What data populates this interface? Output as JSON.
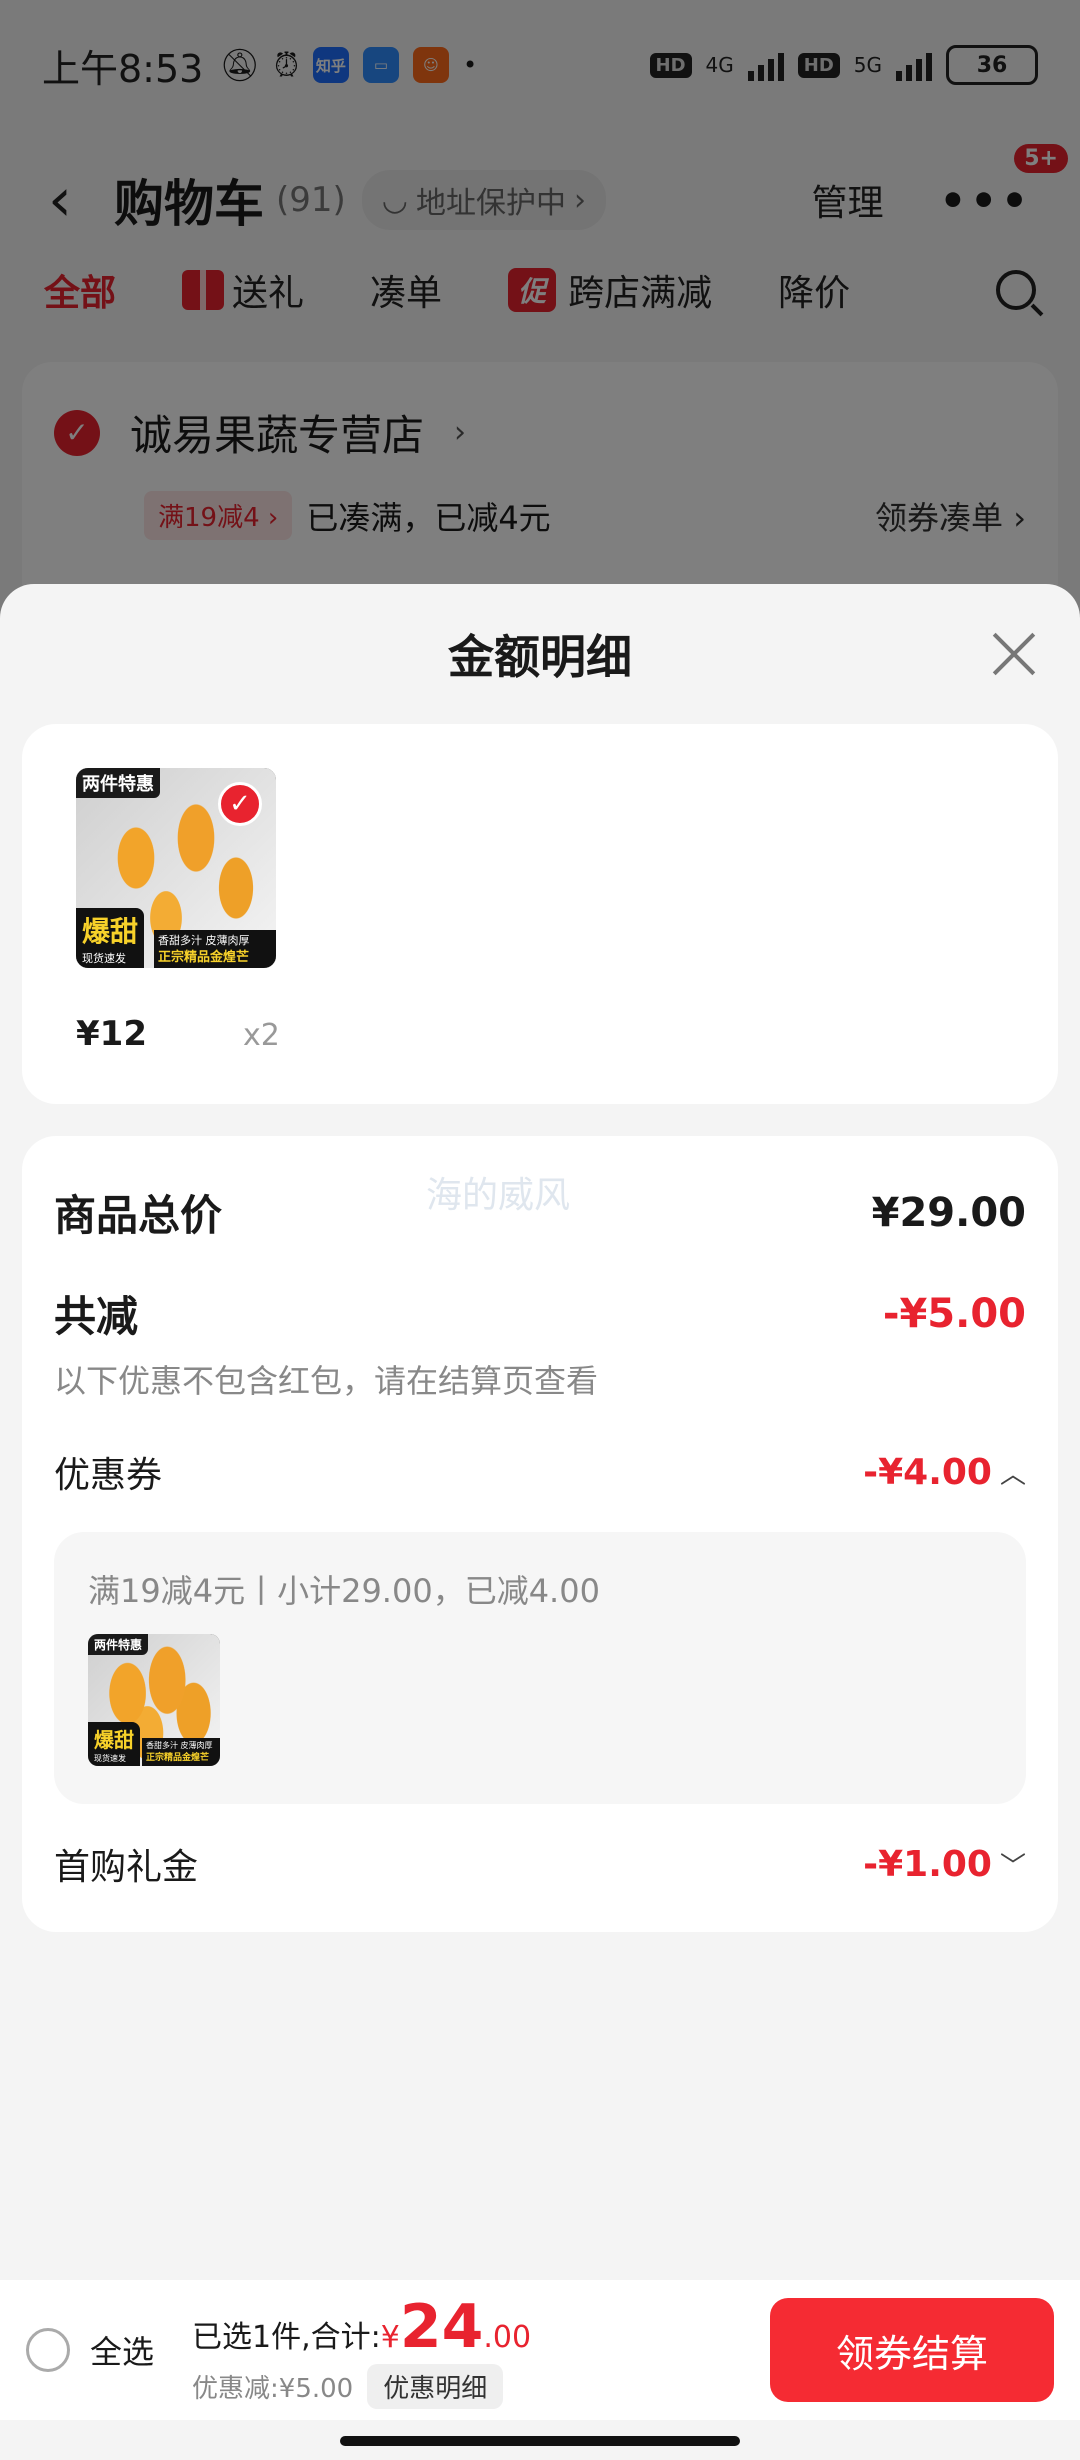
{
  "status_bar": {
    "time": "上午8:53",
    "app_zhihu": "知乎",
    "network_1": "4G",
    "network_2": "5G",
    "hd_label": "HD",
    "battery": "36"
  },
  "nav": {
    "title": "购物车",
    "count": "(91)",
    "address_protect": "地址保护中",
    "manage": "管理",
    "more_badge": "5+"
  },
  "tabs": [
    {
      "label": "全部"
    },
    {
      "label": "送礼"
    },
    {
      "label": "凑单"
    },
    {
      "label": "跨店满减",
      "tag": "促"
    },
    {
      "label": "降价"
    }
  ],
  "store": {
    "name": "诚易果蔬专营店",
    "promo_chip": "满19减4",
    "promo_status": "已凑满，已减4元",
    "promo_action": "领券凑单"
  },
  "sheet": {
    "title": "金额明细",
    "item": {
      "badge_top": "两件特惠",
      "badge_bottom": "爆甜",
      "badge_bottom_sub": "现货速发",
      "product_sub": "香甜多汁 皮薄肉厚",
      "product_label": "正宗精品金煌芒",
      "price": "¥12",
      "qty": "x2"
    },
    "watermark": "海的威风",
    "total_label": "商品总价",
    "total_value": "¥29.00",
    "reduce_label": "共减",
    "reduce_value": "-¥5.00",
    "reduce_note": "以下优惠不包含红包，请在结算页查看",
    "coupon_label": "优惠券",
    "coupon_value": "-¥4.00",
    "coupon_detail": "满19减4元丨小计29.00，已减4.00",
    "first_buy_label": "首购礼金",
    "first_buy_value": "-¥1.00"
  },
  "bottom": {
    "select_all": "全选",
    "selected_text": "已选1件,合计:",
    "yen": "¥",
    "amount_int": "24",
    "amount_dec": ".00",
    "discount_text": "优惠减:¥5.00",
    "detail_chip": "优惠明细",
    "checkout": "领券结算"
  },
  "colors": {
    "accent_red": "#e8232f",
    "checkout_red": "#f52b33"
  }
}
